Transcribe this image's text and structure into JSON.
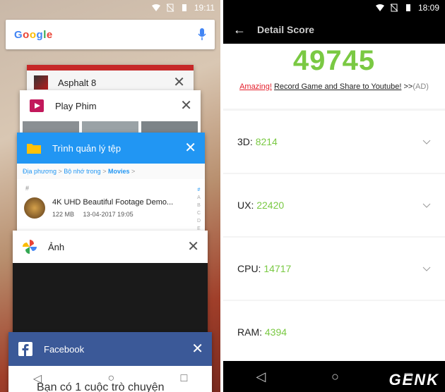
{
  "left_phone": {
    "status_time": "19:11",
    "google": {
      "logo": "Google"
    },
    "cards": [
      {
        "title": "Asphalt 8",
        "icon": "asphalt-icon"
      },
      {
        "title": "Play Phim",
        "icon": "play-movies-icon"
      },
      {
        "title": "Trình quản lý tệp",
        "icon": "folder-icon",
        "breadcrumb": [
          "Địa phương",
          ">",
          "Bộ nhớ trong",
          ">",
          "Movies",
          ">"
        ],
        "list_header": "#",
        "file": {
          "name": "4K UHD Beautiful Footage Demo...",
          "size": "122 MB",
          "date": "13-04-2017 19:05"
        },
        "index_letters": [
          "#",
          "A",
          "B",
          "C",
          "D",
          "E"
        ]
      },
      {
        "title": "Ảnh",
        "icon": "photos-pinwheel-icon"
      },
      {
        "title": "Facebook",
        "icon": "facebook-icon",
        "preview": "Bạn có 1 cuộc trò chuyện"
      }
    ]
  },
  "right_phone": {
    "status_time": "18:09",
    "header_title": "Detail Score",
    "total_score": "49745",
    "promo": {
      "amazing": "Amazing!",
      "record": "Record Game and Share to Youtube!",
      "arrows": ">>",
      "ad": "(AD)"
    },
    "rows": [
      {
        "label": "3D:",
        "value": "8214"
      },
      {
        "label": "UX:",
        "value": "22420"
      },
      {
        "label": "CPU:",
        "value": "14717"
      },
      {
        "label": "RAM:",
        "value": "4394"
      }
    ],
    "watermark": "GENK"
  },
  "colors": {
    "score_green": "#7ac943",
    "fb_blue": "#3b5998",
    "files_blue": "#2196f3",
    "promo_red": "#e41e2b"
  }
}
